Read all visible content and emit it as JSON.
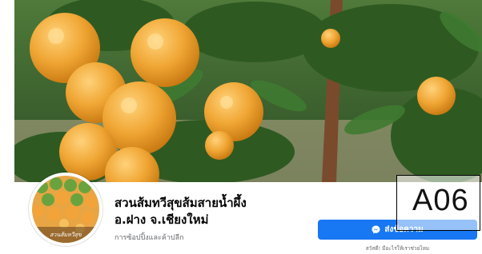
{
  "page": {
    "name_line1": "สวนส้มทวีสุขส้มสายน้ำผึ้ง",
    "name_line2": "อ.ฝาง จ.เชียงใหม่",
    "category": "การซ้อปปิ้งและค้าปลีก"
  },
  "avatar": {
    "caption": "สวนส้มทวีสุข",
    "icon": "orange-crate-photo"
  },
  "cover": {
    "icon": "orange-tree-photo"
  },
  "actions": {
    "send_message_label": "ส่งข้อความ",
    "send_message_icon": "messenger-icon",
    "reply_note": "สวัสดี! มีอะไรให้เราช่วยไหม"
  },
  "overlay": {
    "code": "A06"
  },
  "colors": {
    "primary_button": "#1877f2",
    "secondary_text": "#65676b",
    "primary_text": "#050505"
  }
}
